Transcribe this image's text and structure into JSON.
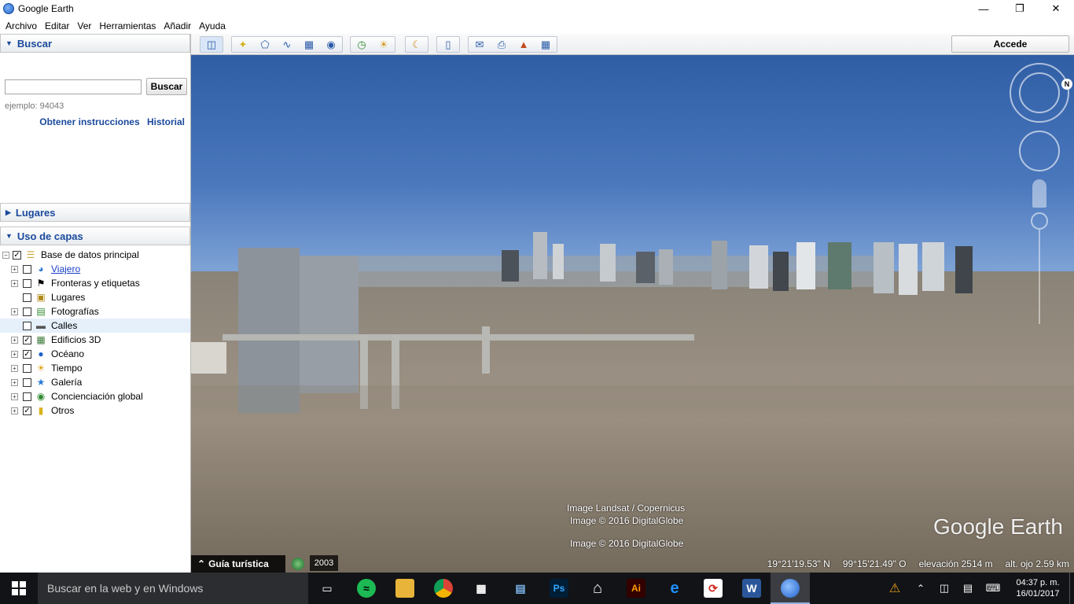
{
  "window": {
    "title": "Google Earth"
  },
  "menu": [
    "Archivo",
    "Editar",
    "Ver",
    "Herramientas",
    "Añadir",
    "Ayuda"
  ],
  "search": {
    "header": "Buscar",
    "input_value": "",
    "button_label": "Buscar",
    "example": "ejemplo: 94043",
    "link_directions": "Obtener instrucciones",
    "link_history": "Historial"
  },
  "places": {
    "header": "Lugares"
  },
  "layers": {
    "header": "Uso de capas",
    "root": {
      "label": "Base de datos principal",
      "checked": true
    },
    "items": [
      {
        "label": "Viajero",
        "checked": false,
        "icon": "globe-icon",
        "link": true
      },
      {
        "label": "Fronteras y etiquetas",
        "checked": false,
        "icon": "flag-icon"
      },
      {
        "label": "Lugares",
        "checked": false,
        "icon": "place-icon"
      },
      {
        "label": "Fotografías",
        "checked": false,
        "icon": "photo-icon"
      },
      {
        "label": "Calles",
        "checked": false,
        "icon": "road-icon"
      },
      {
        "label": "Edificios 3D",
        "checked": true,
        "icon": "building-icon"
      },
      {
        "label": "Océano",
        "checked": true,
        "icon": "ocean-icon"
      },
      {
        "label": "Tiempo",
        "checked": false,
        "icon": "weather-icon"
      },
      {
        "label": "Galería",
        "checked": false,
        "icon": "gallery-icon"
      },
      {
        "label": "Concienciación global",
        "checked": false,
        "icon": "earth-icon"
      },
      {
        "label": "Otros",
        "checked": true,
        "icon": "folder-icon"
      }
    ]
  },
  "toolbar": {
    "signin_label": "Accede"
  },
  "viewport": {
    "credit1": "Image Landsat / Copernicus",
    "credit2": "Image © 2016 DigitalGlobe",
    "credit3": "Image © 2016 DigitalGlobe",
    "logo": "Google Earth"
  },
  "status": {
    "guide": "Guía turística",
    "year": "2003",
    "lat": "19°21'19.53\" N",
    "lon": "99°15'21.49\" O",
    "elevation": "elevación  2514 m",
    "eye_alt": "alt. ojo   2.59 km"
  },
  "taskbar": {
    "search_placeholder": "Buscar en la web y en Windows",
    "time": "04:37 p. m.",
    "date": "16/01/2017"
  }
}
